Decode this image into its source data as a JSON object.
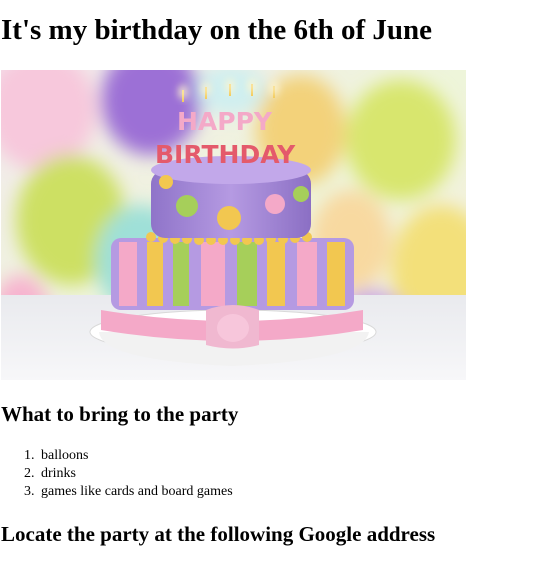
{
  "page": {
    "title": "It's my birthday on the 6th of June",
    "section_bring": {
      "heading": "What to bring to the party",
      "items": [
        {
          "num": "1.",
          "text": "balloons"
        },
        {
          "num": "2.",
          "text": "drinks"
        },
        {
          "num": "3.",
          "text": "games like cards and board games"
        }
      ]
    },
    "section_locate": {
      "heading": "Locate the party at the following Google address"
    },
    "image": {
      "cake_letters_top": "HAPPY",
      "cake_letters_bottom": "BIRTHDAY"
    }
  },
  "colors": {
    "cake_purple": "#a98bd6",
    "ribbon_pink": "#f4a9c8",
    "stripe_yellow": "#f2c750",
    "stripe_green": "#a6cf5a",
    "balloon_purple": "#9c6fd6",
    "balloon_lime": "#d6e66a",
    "balloon_yellow": "#f4e37a",
    "balloon_pink": "#f7b3cf"
  }
}
